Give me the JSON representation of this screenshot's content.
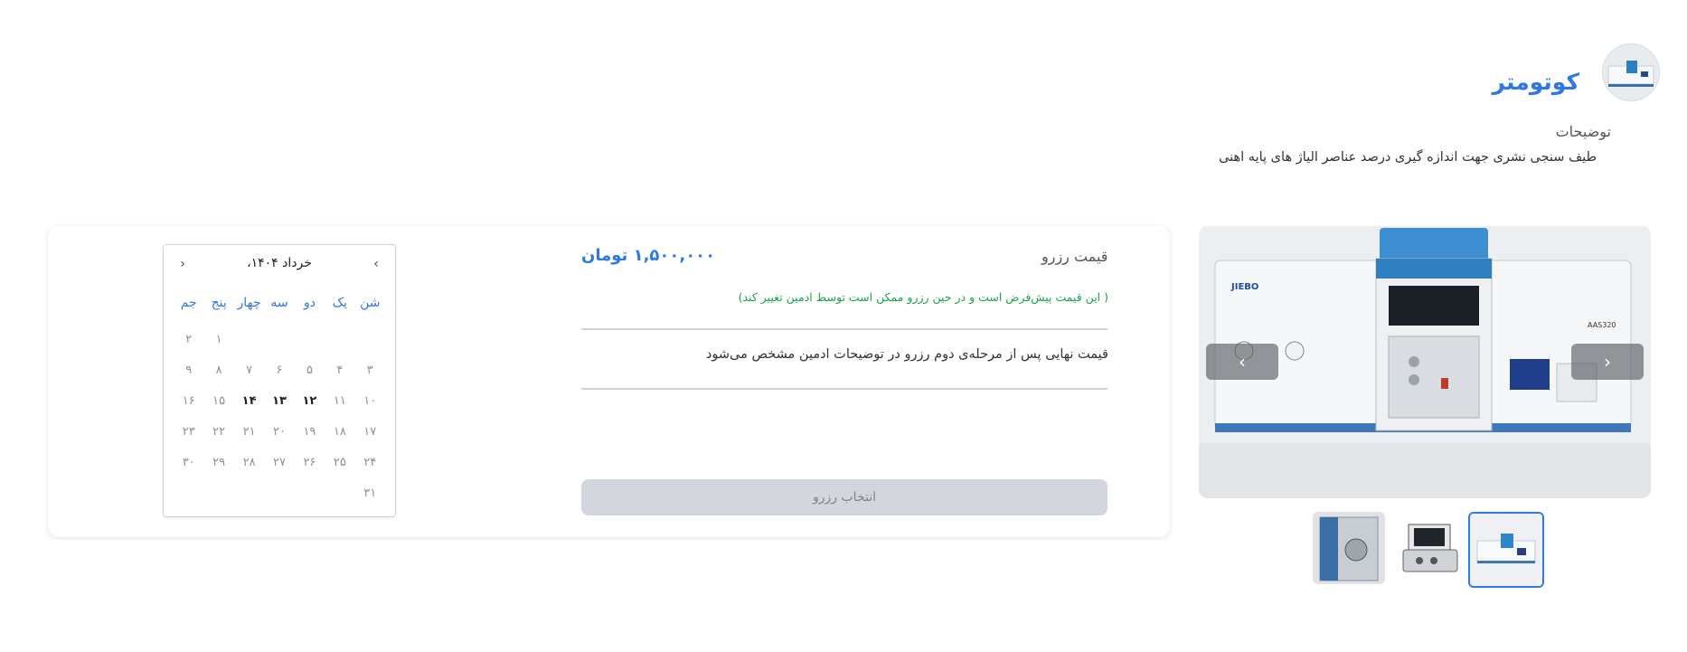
{
  "header": {
    "title": "کوتومتر",
    "description_label": "توضیحات",
    "description_text": "طیف سنجی نشری جهت اندازه گیری درصد عناصر الیاژ های پایه اهنی"
  },
  "pricing": {
    "label": "قیمت رزرو",
    "value": "۱,۵۰۰,۰۰۰ تومان",
    "note": "( این قیمت پیش‌فرض است و در حین رزرو ممکن است توسط ادمین تغییر کند)",
    "final_note": "قیمت نهایی پس از مرحله‌ی دوم رزرو در توضیحات ادمین مشخص می‌شود",
    "button_label": "انتخاب رزرو"
  },
  "calendar": {
    "month_label": "خرداد ۱۴۰۴،",
    "prev_icon": "‹",
    "next_icon": "›",
    "weekdays": [
      "شن",
      "یک",
      "دو",
      "سه",
      "چهار",
      "پنج",
      "جم"
    ],
    "weeks": [
      [
        "",
        "",
        "",
        "",
        "",
        "۱",
        "۲"
      ],
      [
        "۳",
        "۴",
        "۵",
        "۶",
        "۷",
        "۸",
        "۹"
      ],
      [
        "۱۰",
        "۱۱",
        "۱۲",
        "۱۳",
        "۱۴",
        "۱۵",
        "۱۶"
      ],
      [
        "۱۷",
        "۱۸",
        "۱۹",
        "۲۰",
        "۲۱",
        "۲۲",
        "۲۳"
      ],
      [
        "۲۴",
        "۲۵",
        "۲۶",
        "۲۷",
        "۲۸",
        "۲۹",
        "۳۰"
      ],
      [
        "۳۱",
        "",
        "",
        "",
        "",
        "",
        ""
      ]
    ],
    "available_days": [
      "۱۲",
      "۱۳",
      "۱۴"
    ]
  },
  "gallery": {
    "main_image_label": "AAS320",
    "brand_label": "JIEBO",
    "prev_icon": "‹",
    "next_icon": "›",
    "thumbnails": [
      "thumb-aas-spectrometer",
      "thumb-portable-case",
      "thumb-tensile-machine"
    ],
    "selected_thumbnail": 0
  },
  "colors": {
    "accent": "#2f78e6",
    "note_green": "#1aa34a",
    "button_disabled": "#d3d6dc"
  }
}
